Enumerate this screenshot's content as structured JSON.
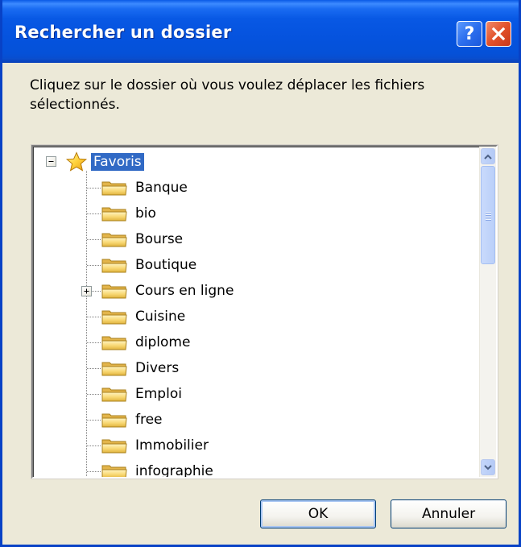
{
  "window": {
    "title": "Rechercher un dossier",
    "help_label": "?",
    "title_bar_color": "#0553DE"
  },
  "instruction": "Cliquez sur le dossier où vous voulez déplacer les fichiers sélectionnés.",
  "tree": {
    "root": {
      "label": "Favoris",
      "expanded": true,
      "selected": true,
      "icon": "star-icon"
    },
    "items": [
      {
        "label": "Banque",
        "icon": "folder-icon"
      },
      {
        "label": "bio",
        "icon": "folder-icon"
      },
      {
        "label": "Bourse",
        "icon": "folder-icon"
      },
      {
        "label": "Boutique",
        "icon": "folder-icon"
      },
      {
        "label": "Cours en ligne",
        "icon": "folder-icon",
        "has_children": true
      },
      {
        "label": "Cuisine",
        "icon": "folder-icon"
      },
      {
        "label": "diplome",
        "icon": "folder-icon"
      },
      {
        "label": "Divers",
        "icon": "folder-icon"
      },
      {
        "label": "Emploi",
        "icon": "folder-icon"
      },
      {
        "label": "free",
        "icon": "folder-icon"
      },
      {
        "label": "Immobilier",
        "icon": "folder-icon"
      },
      {
        "label": "infographie",
        "icon": "folder-icon"
      }
    ],
    "selection_color": "#316AC5"
  },
  "buttons": {
    "ok": "OK",
    "cancel": "Annuler"
  }
}
